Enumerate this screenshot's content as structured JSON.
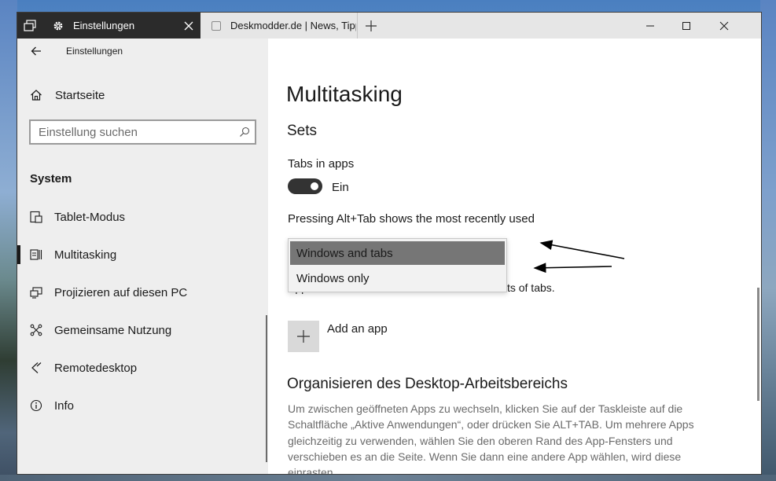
{
  "window": {
    "tabs": [
      {
        "title": "Einstellungen",
        "active": true
      },
      {
        "title": "Deskmodder.de | News, Tipps",
        "active": false
      }
    ]
  },
  "sidebar": {
    "back_label": "Einstellungen",
    "home_label": "Startseite",
    "search_placeholder": "Einstellung suchen",
    "group_title": "System",
    "items": [
      {
        "label": "Tablet-Modus",
        "icon": "tablet-mode-icon"
      },
      {
        "label": "Multitasking",
        "icon": "multitasking-icon",
        "selected": true
      },
      {
        "label": "Projizieren auf diesen PC",
        "icon": "project-icon"
      },
      {
        "label": "Gemeinsame Nutzung",
        "icon": "shared-experiences-icon"
      },
      {
        "label": "Remotedesktop",
        "icon": "remote-desktop-icon"
      },
      {
        "label": "Info",
        "icon": "info-icon"
      }
    ]
  },
  "content": {
    "page_title": "Multitasking",
    "section_sets": "Sets",
    "tabs_in_apps_label": "Tabs in apps",
    "tabs_toggle_state": "Ein",
    "tabs_toggle_on": true,
    "alt_tab_label": "Pressing Alt+Tab shows the most recently used",
    "alt_tab_options": [
      "Windows and tabs",
      "Windows only"
    ],
    "alt_tab_selected": "Windows and tabs",
    "sets_excluded_text": "Apps added to this list can't be included in sets of tabs.",
    "add_app_label": "Add an app",
    "section_desktop": "Organisieren des Desktop-Arbeitsbereichs",
    "desktop_description": "Um zwischen geöffneten Apps zu wechseln, klicken Sie auf der Taskleiste auf die Schaltfläche „Aktive Anwendungen“, oder drücken Sie ALT+TAB. Um mehrere Apps gleichzeitig zu verwenden, wählen Sie den oberen Rand des App-Fensters und verschieben es an die Seite. Wenn Sie dann eine andere App wählen, wird diese einrasten."
  },
  "colors": {
    "titlebar_dark": "#2b2b2b",
    "sidebar_bg": "#eeeeee",
    "selected_option": "#767676",
    "toggle_on": "#333333"
  }
}
